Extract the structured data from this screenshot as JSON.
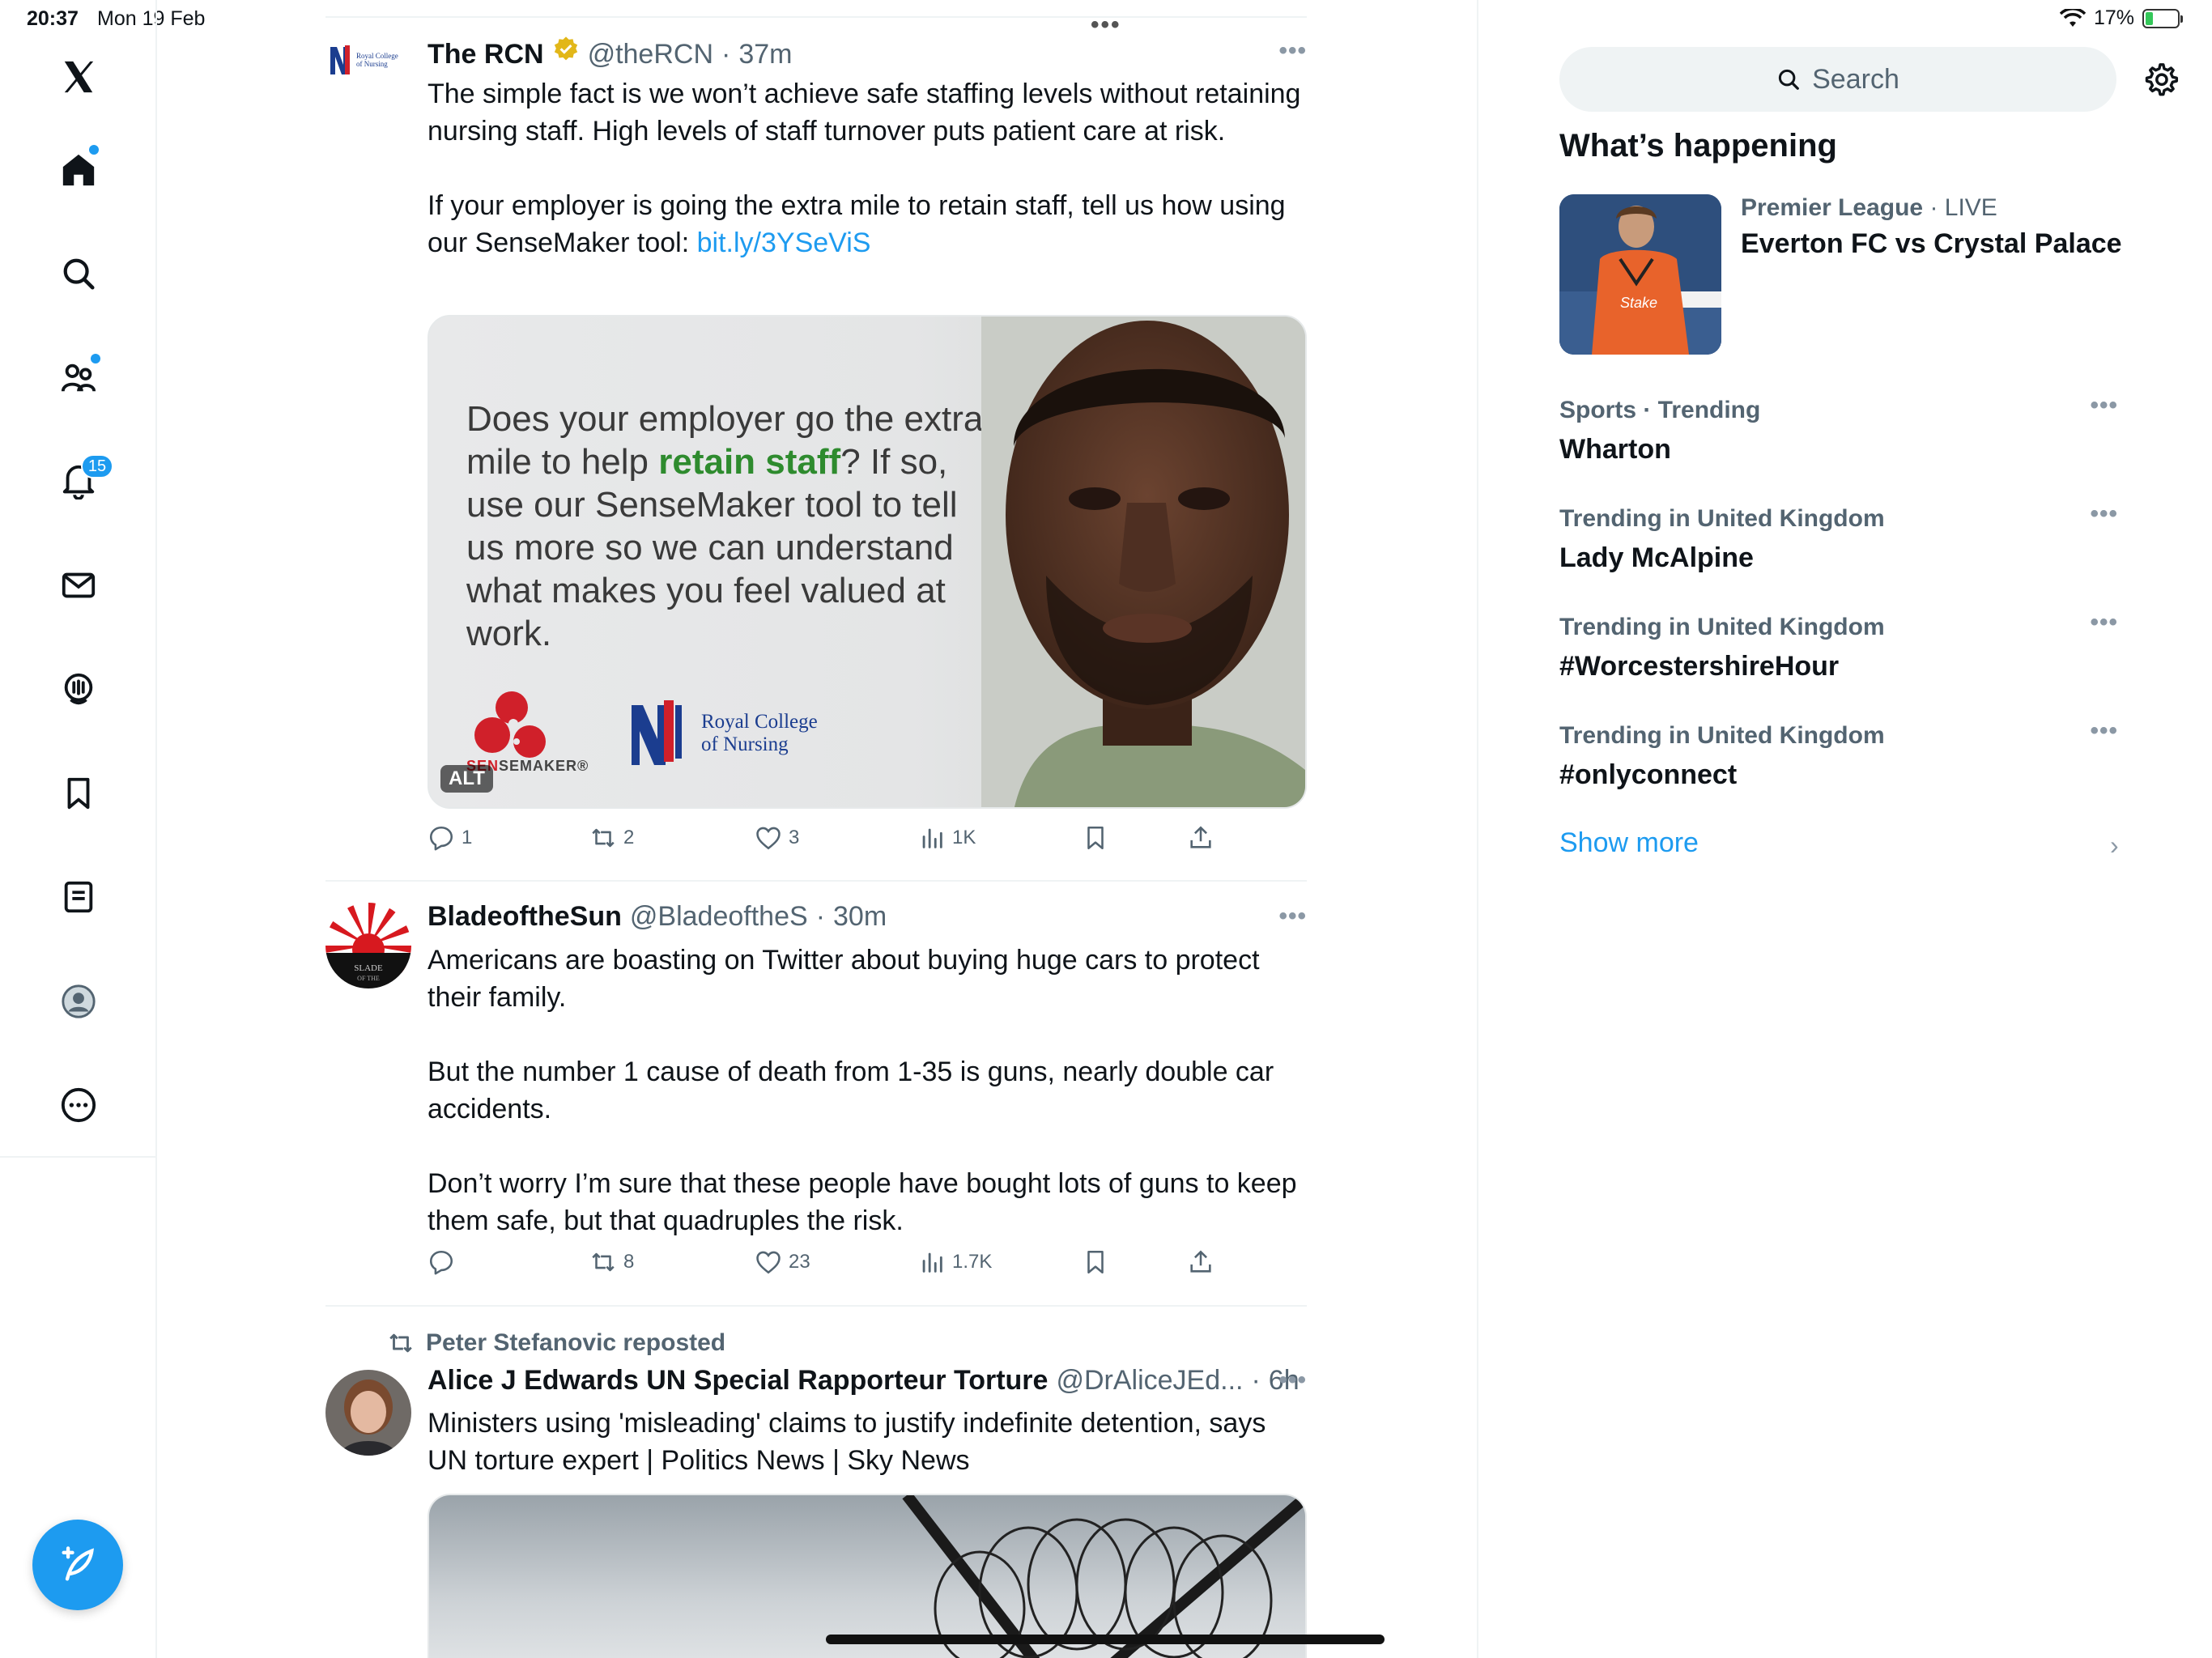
{
  "status_bar": {
    "time": "20:37",
    "date": "Mon 19 Feb",
    "battery_percent": "17%"
  },
  "nav": {
    "notifications_badge": "15"
  },
  "timeline": {
    "tweets": [
      {
        "name": "The RCN",
        "handle": "@theRCN",
        "sep": "·",
        "age": "37m",
        "text_p1": "The simple fact is we won’t achieve safe staffing levels without retaining nursing staff. High levels of staff turnover puts patient care at risk.",
        "text_p2_pre": "If your employer is going the extra mile to retain staff, tell us how using our SenseMaker tool: ",
        "text_p2_link": "bit.ly/3YSeViS",
        "media": {
          "line1_pre": "Does your employer go the extra mile to help ",
          "highlight": "retain staff",
          "line1_post": "?",
          "line2": "If so, use our SenseMaker tool to tell us more so we can understand what makes you feel valued at work.",
          "alt": "ALT",
          "sensemaker_a": "SEN",
          "sensemaker_b": "SEMAKER",
          "sensemaker_reg": "®",
          "rcn_line1": "Royal College",
          "rcn_line2": "of Nursing"
        },
        "replies": "1",
        "reposts": "2",
        "likes": "3",
        "views": "1K"
      },
      {
        "name": "BladeoftheSun",
        "handle": "@BladeoftheS",
        "sep": "·",
        "age": "30m",
        "text_p1": "Americans are boasting on Twitter about buying huge cars to protect their family.",
        "text_p2": "But the number 1 cause of death from 1-35 is guns, nearly double car accidents.",
        "text_p3": "Don’t worry I’m sure that these people have bought lots of guns to keep them safe, but that quadruples the risk.",
        "replies": "",
        "reposts": "8",
        "likes": "23",
        "views": "1.7K"
      },
      {
        "reposted_by": "Peter Stefanovic reposted",
        "name": "Alice J Edwards UN Special Rapporteur Torture",
        "handle": "@DrAliceJEd...",
        "sep": "·",
        "age": "6h",
        "text_p1": "Ministers using 'misleading' claims to justify indefinite detention, says UN torture expert | Politics News | Sky News"
      }
    ]
  },
  "sidebar": {
    "search_placeholder": "Search",
    "whats_happening": "What’s happening",
    "featured": {
      "category": "Premier League",
      "sep": " · ",
      "status": "LIVE",
      "title": "Everton FC vs Crystal Palace"
    },
    "trends": [
      {
        "meta": "Sports · Trending",
        "term": "Wharton"
      },
      {
        "meta": "Trending in United Kingdom",
        "term": "Lady McAlpine"
      },
      {
        "meta": "Trending in United Kingdom",
        "term": "#WorcestershireHour"
      },
      {
        "meta": "Trending in United Kingdom",
        "term": "#onlyconnect"
      }
    ],
    "show_more": "Show more"
  },
  "colors": {
    "accent": "#1d9bf0",
    "text": "#0f1419",
    "muted": "#536471",
    "rcn_green": "#2e8b2e"
  },
  "icons": [
    "x-logo-icon",
    "home-icon",
    "search-icon",
    "communities-icon",
    "bell-icon",
    "mail-icon",
    "spaces-icon",
    "bookmark-icon",
    "lists-icon",
    "profile-icon",
    "more-circle-icon",
    "compose-icon",
    "gear-icon",
    "reply-icon",
    "repost-icon",
    "like-icon",
    "views-icon",
    "share-icon",
    "verified-icon",
    "wifi-icon",
    "battery-icon"
  ]
}
